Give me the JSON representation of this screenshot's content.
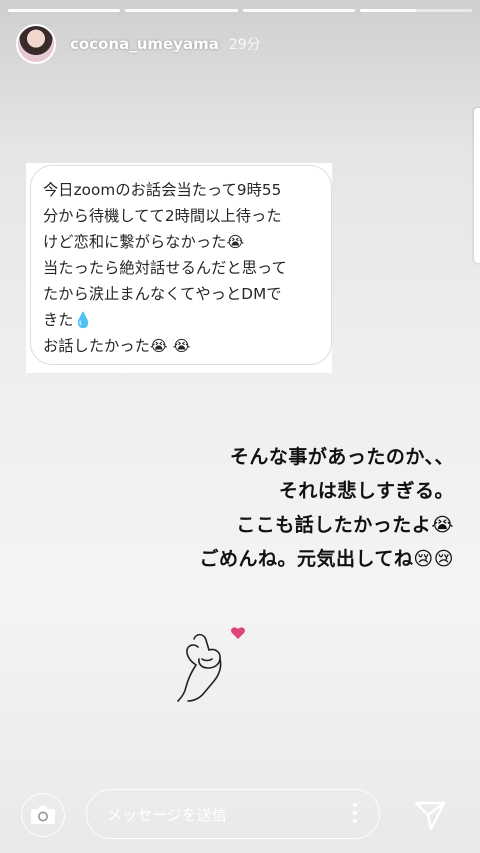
{
  "story": {
    "segments": [
      1,
      1,
      1,
      0.5
    ],
    "username": "cocona_umeyama",
    "time": "29分"
  },
  "dm_message": {
    "lines": [
      "今日zoomのお話会当たって9時55",
      "分から待機してて2時間以上待った",
      "けど恋和に繋がらなかった😭",
      "当たったら絶対話せるんだと思って",
      "たから涙止まんなくてやっとDMで",
      "きた💧",
      "お話したかった😭 😭"
    ]
  },
  "story_text": {
    "lines": [
      "そんな事があったのか、、",
      "それは悲しすぎる。",
      "ここも話したかったよ😭",
      "ごめんね。元気出してね😢😢"
    ]
  },
  "bottom_bar": {
    "message_placeholder": "メッセージを送信"
  }
}
